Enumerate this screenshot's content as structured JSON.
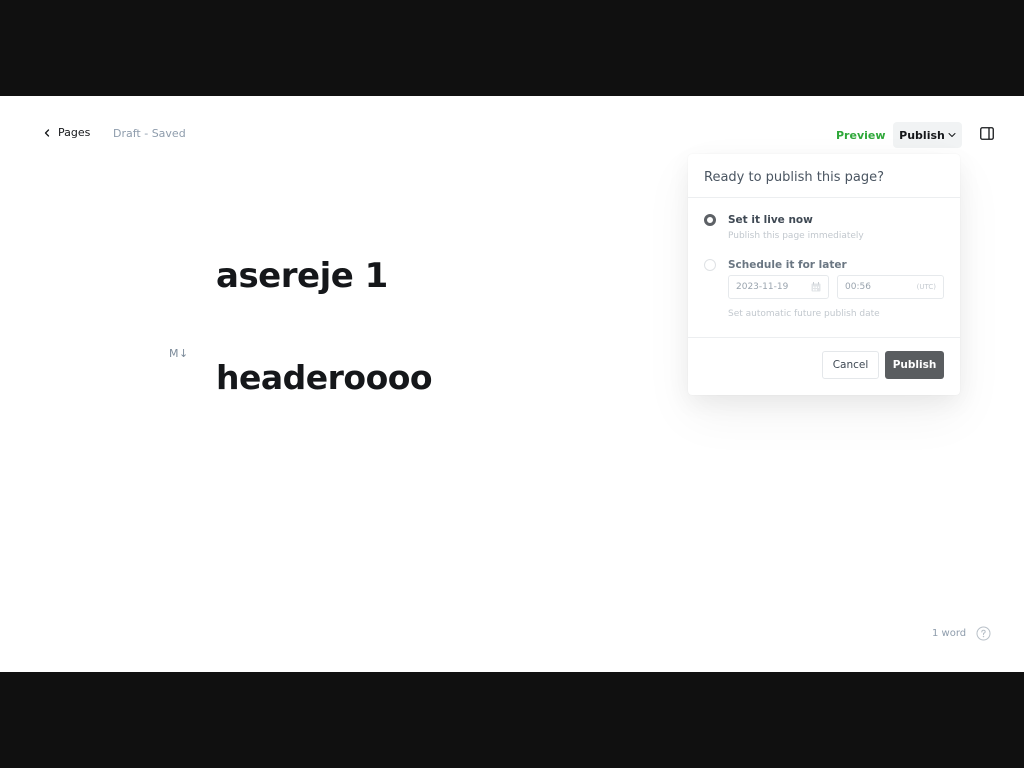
{
  "nav": {
    "back_label": "Pages",
    "status": "Draft - Saved"
  },
  "header_actions": {
    "preview_label": "Preview",
    "publish_label": "Publish",
    "preview_color": "#2fa83a"
  },
  "editor": {
    "title": "asereje 1",
    "heading": "headeroooo",
    "markdown_icon_text": "M↓"
  },
  "footer": {
    "word_count": "1 word"
  },
  "publish_popover": {
    "title": "Ready to publish this page?",
    "options": [
      {
        "label": "Set it live now",
        "sub": "Publish this page immediately",
        "selected": true
      },
      {
        "label": "Schedule it for later",
        "sub": "Set automatic future publish date",
        "selected": false
      }
    ],
    "schedule": {
      "date": "2023-11-19",
      "time": "00:56",
      "timezone": "(UTC)"
    },
    "cancel_label": "Cancel",
    "publish_label": "Publish",
    "publish_button_color": "#5a5d60"
  },
  "icons": {
    "back": "chevron-left-icon",
    "publish_caret": "chevron-down-icon",
    "sidebar": "sidebar-toggle-icon",
    "calendar": "calendar-icon",
    "help": "help-circle-icon"
  }
}
